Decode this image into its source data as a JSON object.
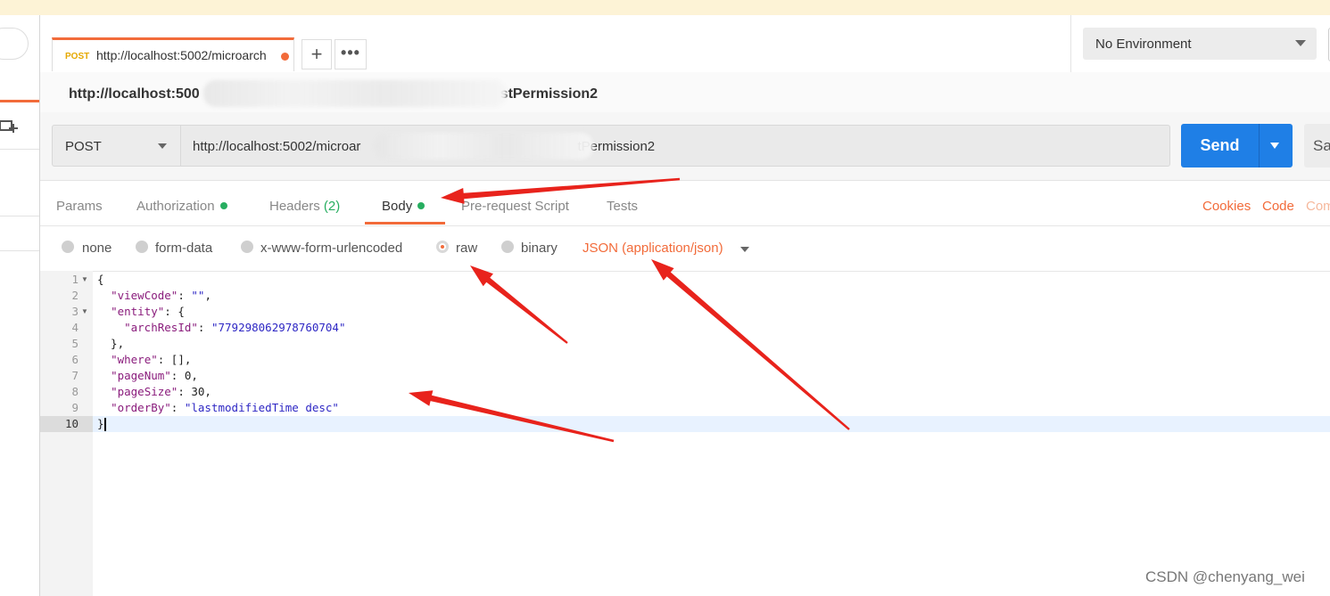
{
  "request_tab": {
    "method": "POST",
    "url": "http://localhost:5002/microarch"
  },
  "environment": {
    "selected": "No Environment"
  },
  "request": {
    "name_start": "http://localhost:500",
    "name_end": "stPermission2",
    "method": "POST",
    "url_start": "http://localhost:5002/microar",
    "url_end": "tPermission2"
  },
  "buttons": {
    "send": "Send",
    "save": "Sa"
  },
  "tabs": {
    "params": "Params",
    "authorization": "Authorization",
    "headers": "Headers",
    "headers_count": "(2)",
    "body": "Body",
    "prerequest": "Pre-request Script",
    "tests": "Tests"
  },
  "links": {
    "cookies": "Cookies",
    "code": "Code",
    "comments": "Com"
  },
  "body_options": {
    "none": "none",
    "form_data": "form-data",
    "urlencoded": "x-www-form-urlencoded",
    "raw": "raw",
    "binary": "binary",
    "content_type": "JSON (application/json)",
    "selected": "raw"
  },
  "editor": {
    "line_numbers": [
      "1",
      "2",
      "3",
      "4",
      "5",
      "6",
      "7",
      "8",
      "9",
      "10"
    ],
    "lines": [
      [
        {
          "t": "{",
          "c": "n"
        }
      ],
      [
        {
          "t": "  ",
          "c": "n"
        },
        {
          "t": "\"viewCode\"",
          "c": "k"
        },
        {
          "t": ": ",
          "c": "n"
        },
        {
          "t": "\"\"",
          "c": "s"
        },
        {
          "t": ",",
          "c": "n"
        }
      ],
      [
        {
          "t": "  ",
          "c": "n"
        },
        {
          "t": "\"entity\"",
          "c": "k"
        },
        {
          "t": ": {",
          "c": "n"
        }
      ],
      [
        {
          "t": "    ",
          "c": "n"
        },
        {
          "t": "\"archResId\"",
          "c": "k"
        },
        {
          "t": ": ",
          "c": "n"
        },
        {
          "t": "\"779298062978760704\"",
          "c": "s"
        }
      ],
      [
        {
          "t": "  },",
          "c": "n"
        }
      ],
      [
        {
          "t": "  ",
          "c": "n"
        },
        {
          "t": "\"where\"",
          "c": "k"
        },
        {
          "t": ": [],",
          "c": "n"
        }
      ],
      [
        {
          "t": "  ",
          "c": "n"
        },
        {
          "t": "\"pageNum\"",
          "c": "k"
        },
        {
          "t": ": 0,",
          "c": "n"
        }
      ],
      [
        {
          "t": "  ",
          "c": "n"
        },
        {
          "t": "\"pageSize\"",
          "c": "k"
        },
        {
          "t": ": 30,",
          "c": "n"
        }
      ],
      [
        {
          "t": "  ",
          "c": "n"
        },
        {
          "t": "\"orderBy\"",
          "c": "k"
        },
        {
          "t": ": ",
          "c": "n"
        },
        {
          "t": "\"lastmodifiedTime desc\"",
          "c": "s"
        }
      ],
      [
        {
          "t": "}",
          "c": "n"
        }
      ]
    ]
  },
  "watermark": "CSDN @chenyang_wei",
  "colors": {
    "accent": "#f26b3a",
    "send": "#1f7fe6",
    "active_dot": "#27ae60",
    "annotation_arrow": "#e8231c"
  }
}
